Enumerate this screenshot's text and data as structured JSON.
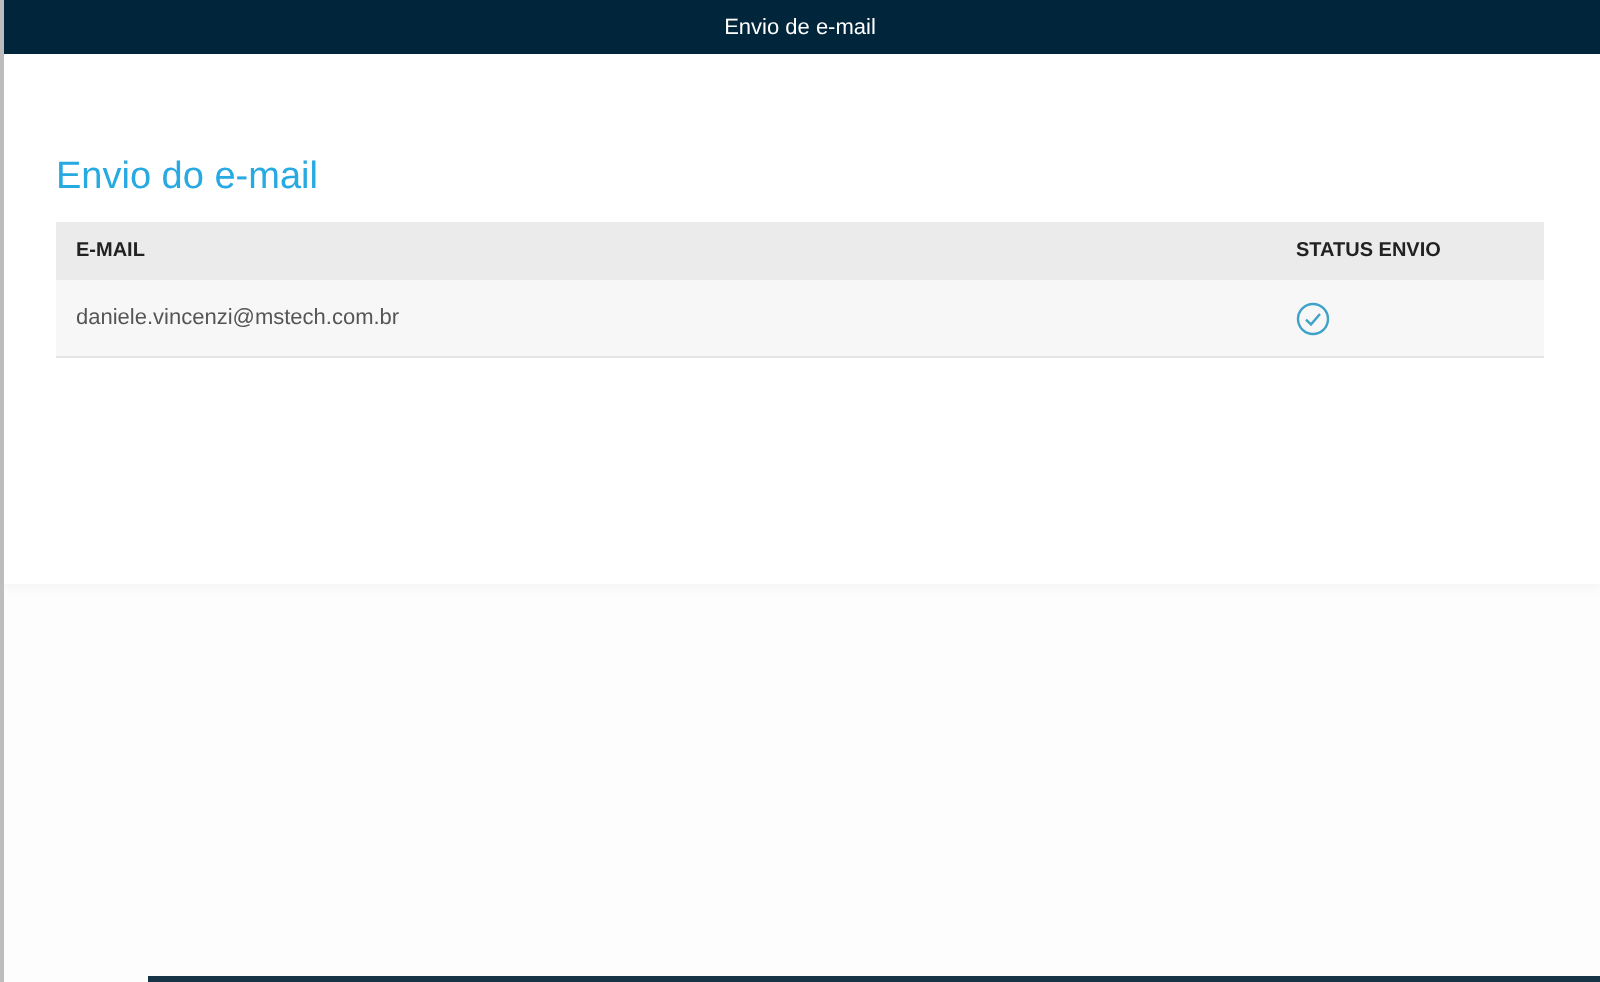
{
  "window": {
    "title": "Envio de e-mail"
  },
  "heading": "Envio do e-mail",
  "table": {
    "columns": [
      "E-MAIL",
      "STATUS ENVIO"
    ],
    "rows": [
      {
        "email": "daniele.vincenzi@mstech.com.br",
        "sent": true
      }
    ]
  }
}
